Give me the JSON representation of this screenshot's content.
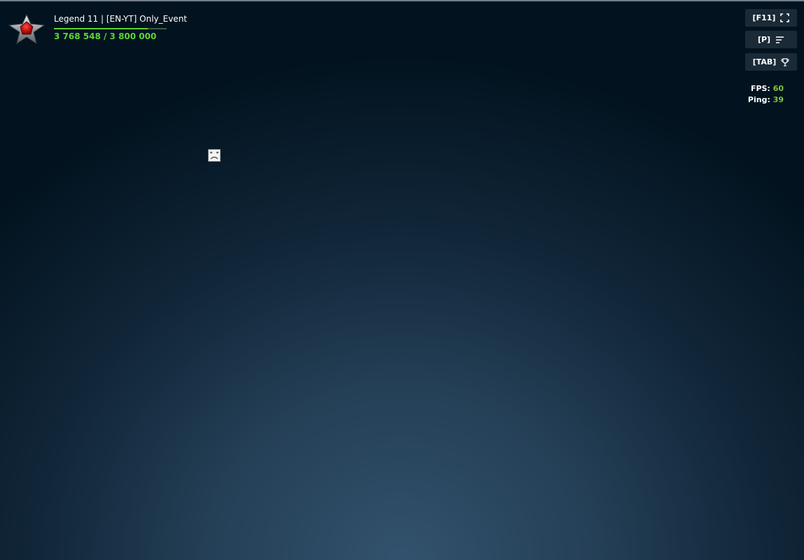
{
  "player": {
    "name": "Legend 11 | [EN-YT] Only_Event",
    "xp_text": "3 768 548 / 3 800 000",
    "xp_progress": 0.83,
    "rank_icon": "legend-star-icon"
  },
  "controls": {
    "fullscreen": {
      "key": "[F11]",
      "icon": "fullscreen-icon"
    },
    "players": {
      "key": "[P]",
      "icon": "list-icon"
    },
    "scores": {
      "key": "[TAB]",
      "icon": "trophy-icon"
    }
  },
  "stats": {
    "fps_label": "FPS:",
    "fps_value": "60",
    "ping_label": "Ping:",
    "ping_value": "39"
  },
  "colors": {
    "xp_green": "#5fd335",
    "stat_value_green": "#86c23a",
    "background_center": "#33526d",
    "background_edge": "#02131f"
  }
}
